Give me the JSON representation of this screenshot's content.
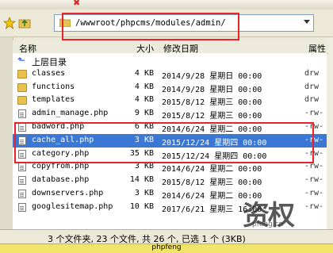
{
  "path": {
    "value": "/wwwroot/phpcms/modules/admin/"
  },
  "columns": {
    "name": "名称",
    "size": "大小",
    "modified": "修改日期",
    "perm": "属性"
  },
  "up_label": "上层目录",
  "files": [
    {
      "name": "classes",
      "size": "4 KB",
      "date": "2014/9/28 星期日 00:00",
      "perm": "drw",
      "type": "folder"
    },
    {
      "name": "functions",
      "size": "4 KB",
      "date": "2014/9/28 星期日 00:00",
      "perm": "drw",
      "type": "folder"
    },
    {
      "name": "templates",
      "size": "4 KB",
      "date": "2015/8/12 星期三 00:00",
      "perm": "drw",
      "type": "folder"
    },
    {
      "name": "admin_manage.php",
      "size": "9 KB",
      "date": "2015/8/12 星期三 00:00",
      "perm": "-rw-",
      "type": "file"
    },
    {
      "name": "badword.php",
      "size": "6 KB",
      "date": "2014/6/24 星期二 00:00",
      "perm": "-rw-",
      "type": "file"
    },
    {
      "name": "cache_all.php",
      "size": "3 KB",
      "date": "2015/12/24 星期四 00:00",
      "perm": "-rw-",
      "type": "file",
      "selected": true
    },
    {
      "name": "category.php",
      "size": "35 KB",
      "date": "2015/12/24 星期四 00:00",
      "perm": "-rw-",
      "type": "file"
    },
    {
      "name": "copyfrom.php",
      "size": "3 KB",
      "date": "2014/6/24 星期二 00:00",
      "perm": "-rw-",
      "type": "file"
    },
    {
      "name": "database.php",
      "size": "14 KB",
      "date": "2015/8/12 星期三 00:00",
      "perm": "-rw-",
      "type": "file"
    },
    {
      "name": "downservers.php",
      "size": "3 KB",
      "date": "2014/6/24 星期二 00:00",
      "perm": "-rw-",
      "type": "file"
    },
    {
      "name": "googlesitemap.php",
      "size": "10 KB",
      "date": "2017/6/21 星期三 16:00",
      "perm": "-rw-",
      "type": "file"
    }
  ],
  "status": "3 个文件夹, 23 个文件, 共 26 个, 已选 1 个 (3KB)",
  "tab": "phpfeng",
  "watermark": {
    "char": "资权",
    "domain": "pfeng.cn"
  },
  "colors": {
    "selection": "#3b77d4",
    "annotation": "#e8232b",
    "tab": "#f2e36a"
  }
}
